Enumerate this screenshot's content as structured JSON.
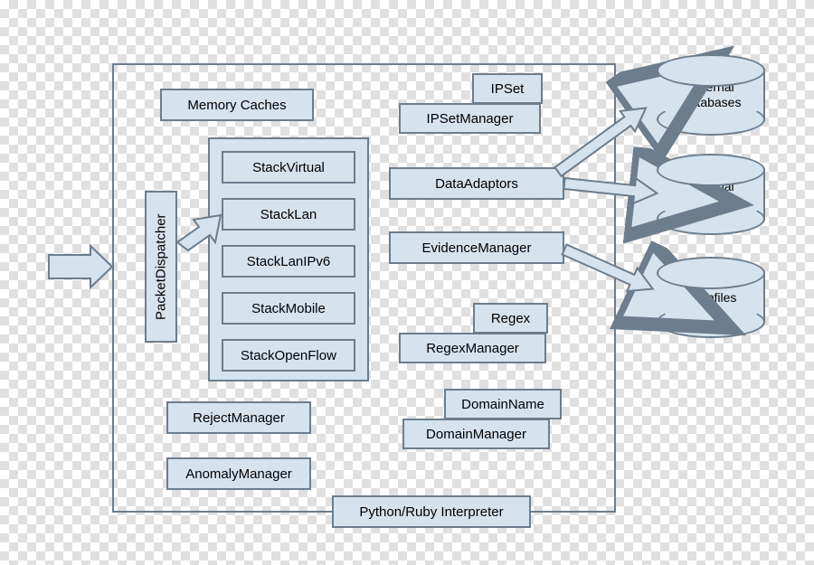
{
  "colors": {
    "fill": "#d5e3ef",
    "stroke": "#6c7d8d"
  },
  "main": {
    "memory_caches": "Memory Caches",
    "packet_dispatcher": "PacketDispatcher",
    "stacks": {
      "virtual": "StackVirtual",
      "lan": "StackLan",
      "lan_ipv6": "StackLanIPv6",
      "mobile": "StackMobile",
      "openflow": "StackOpenFlow"
    },
    "ipset": "IPSet",
    "ipset_manager": "IPSetManager",
    "data_adaptors": "DataAdaptors",
    "evidence_manager": "EvidenceManager",
    "regex": "Regex",
    "regex_manager": "RegexManager",
    "domain_name": "DomainName",
    "domain_manager": "DomainManager",
    "reject_manager": "RejectManager",
    "anomaly_manager": "AnomalyManager",
    "interpreter": "Python/Ruby Interpreter"
  },
  "external": {
    "db1": "External\nDatabases",
    "db2": "External\nDatabases",
    "pcap": "Pcapfiles"
  }
}
